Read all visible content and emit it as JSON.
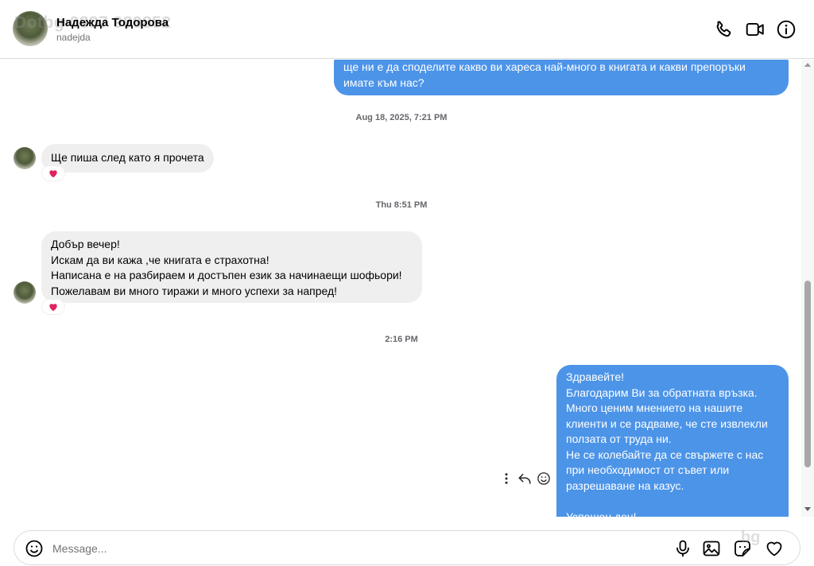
{
  "header": {
    "name": "Надежда Тодорова",
    "username": "nadejda",
    "watermark": "Dotbg 0887 989852",
    "icons": [
      "phone-icon",
      "video-call-icon",
      "info-icon"
    ]
  },
  "thread": {
    "msg1": {
      "lines": "ще ни е да споделите какво ви хареса най-много в книгата и какви препоръки\nимате към нас?"
    },
    "ts1": "Aug 18, 2025, 7:21 PM",
    "msg2": {
      "text": "Ще пиша след като я прочета",
      "reaction": "heart"
    },
    "ts2": "Thu 8:51 PM",
    "msg3": {
      "lines": "Добър вечер!\nИскам да ви кажа ,че книгата е страхотна!\nНаписана е на разбираем и достъпен език за начинаещи шофьори!\nПожелавам ви много тиражи и много успехи за напред!",
      "reaction": "heart"
    },
    "ts3": "2:16 PM",
    "msg4": {
      "lines": "Здравейте!\nБлагодарим Ви за обратната връзка.\nМного ценим мнението на нашите\nклиенти и се радваме, че сте извлекли\nползата от труда ни.\nНе се колебайте да се свържете с нас\nпри необходимост от съвет или\nразрешаване на казус.\n\nУспешен ден!"
    },
    "message_actions": [
      "more-icon",
      "reply-icon",
      "emoji-react-icon"
    ]
  },
  "composer": {
    "placeholder": "Message...",
    "value": "",
    "icons": [
      "emoji-icon",
      "microphone-icon",
      "image-icon",
      "sticker-icon",
      "heart-icon"
    ],
    "brand_mark": "bg"
  },
  "colors": {
    "outgoing_bubble": "#4c94e8",
    "incoming_bubble": "#efefef",
    "reaction_heart": "#e0245e"
  }
}
